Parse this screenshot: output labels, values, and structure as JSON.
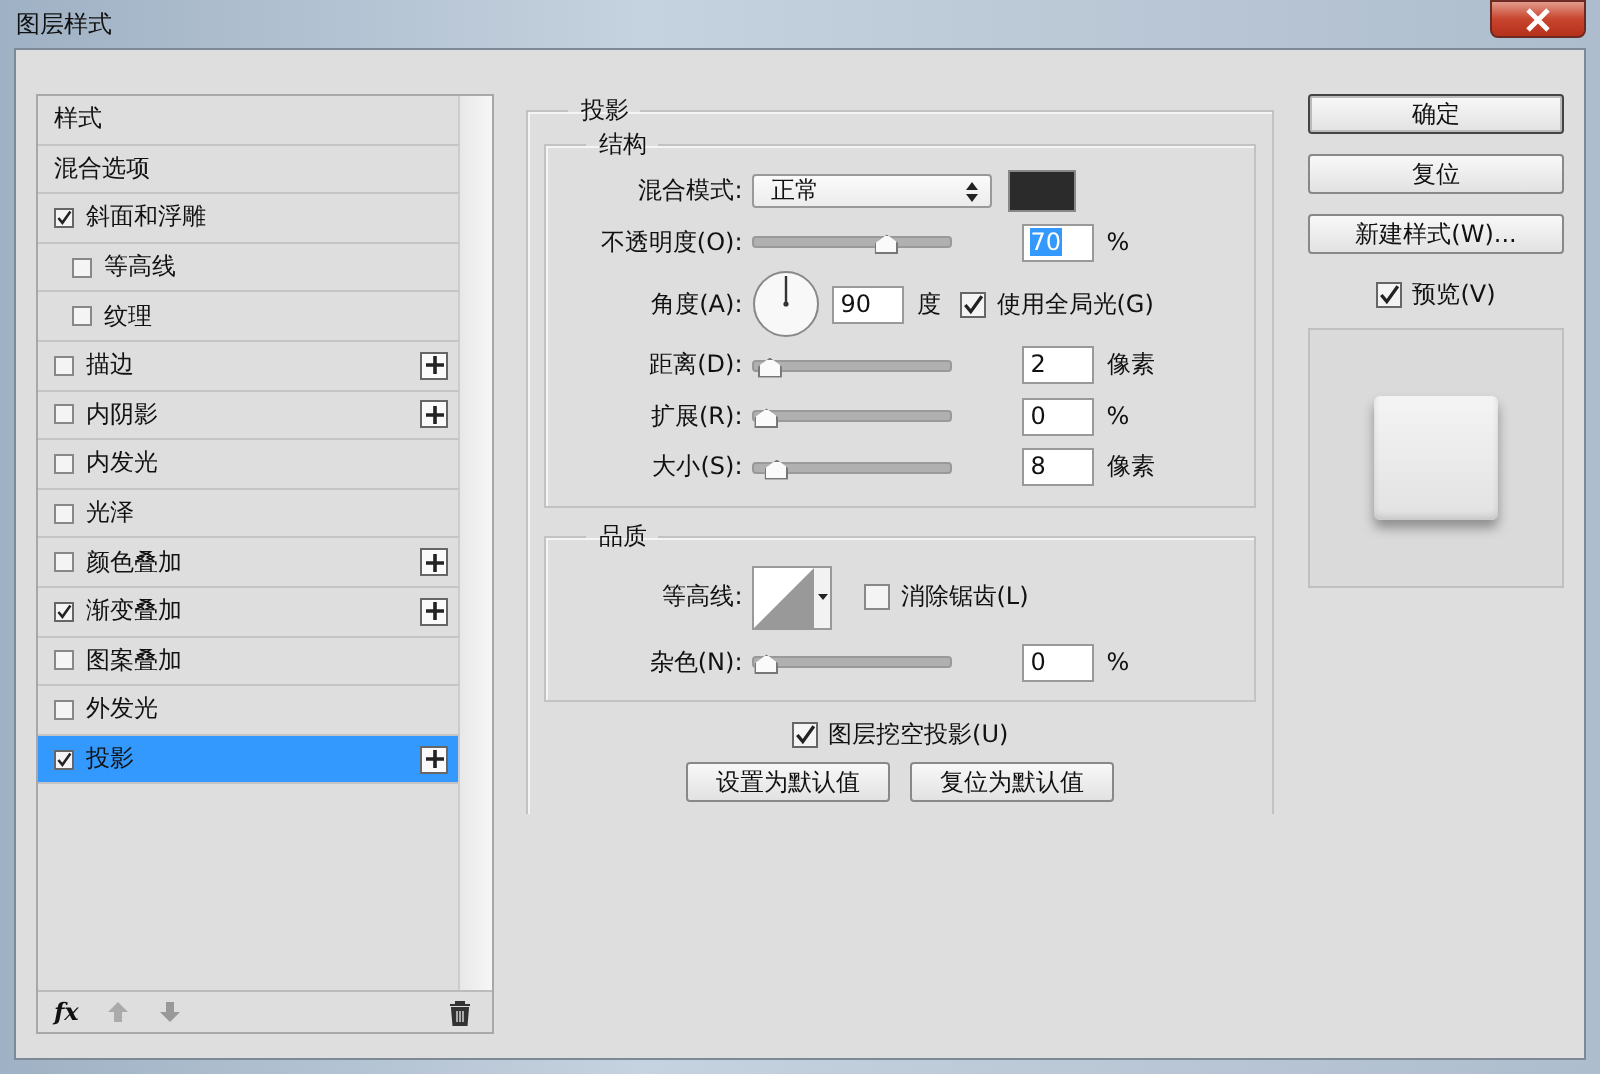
{
  "window": {
    "title": "图层样式"
  },
  "styles": {
    "items": [
      {
        "kind": "header",
        "label": "样式",
        "selected": false
      },
      {
        "kind": "plain",
        "label": "混合选项",
        "selected": false
      },
      {
        "kind": "check",
        "label": "斜面和浮雕",
        "checked": true,
        "selected": false,
        "plus": false,
        "children": [
          {
            "kind": "check",
            "label": "等高线",
            "checked": false,
            "selected": false,
            "plus": false
          },
          {
            "kind": "check",
            "label": "纹理",
            "checked": false,
            "selected": false,
            "plus": false
          }
        ]
      },
      {
        "kind": "check",
        "label": "描边",
        "checked": false,
        "selected": false,
        "plus": true
      },
      {
        "kind": "check",
        "label": "内阴影",
        "checked": false,
        "selected": false,
        "plus": true
      },
      {
        "kind": "check",
        "label": "内发光",
        "checked": false,
        "selected": false,
        "plus": false
      },
      {
        "kind": "check",
        "label": "光泽",
        "checked": false,
        "selected": false,
        "plus": false
      },
      {
        "kind": "check",
        "label": "颜色叠加",
        "checked": false,
        "selected": false,
        "plus": true
      },
      {
        "kind": "check",
        "label": "渐变叠加",
        "checked": true,
        "selected": false,
        "plus": true
      },
      {
        "kind": "check",
        "label": "图案叠加",
        "checked": false,
        "selected": false,
        "plus": false
      },
      {
        "kind": "check",
        "label": "外发光",
        "checked": false,
        "selected": false,
        "plus": false
      },
      {
        "kind": "check",
        "label": "投影",
        "checked": true,
        "selected": true,
        "plus": true
      }
    ],
    "footer": {
      "fx": "fx"
    }
  },
  "panel": {
    "title": "投影",
    "structure": {
      "title": "结构",
      "blend_mode": {
        "label": "混合模式:",
        "value": "正常"
      },
      "opacity": {
        "label": "不透明度(O):",
        "level": 0.7,
        "value": "70",
        "unit": "%",
        "selected": true
      },
      "angle": {
        "label": "角度(A):",
        "value": "90",
        "unit": "度",
        "global_light": {
          "label": "使用全局光(G)",
          "checked": true
        }
      },
      "sliders": [
        {
          "label": "距离(D):",
          "level": 0.02,
          "value": "2",
          "unit": "像素",
          "selected": false
        },
        {
          "label": "扩展(R):",
          "level": 0,
          "value": "0",
          "unit": "%",
          "selected": false
        },
        {
          "label": "大小(S):",
          "level": 0.06,
          "value": "8",
          "unit": "像素",
          "selected": false
        }
      ]
    },
    "quality": {
      "title": "品质",
      "contour": {
        "label": "等高线:",
        "antialias": {
          "label": "消除锯齿(L)",
          "checked": false
        }
      },
      "noise": {
        "label": "杂色(N):",
        "level": 0,
        "value": "0",
        "unit": "%",
        "selected": false
      }
    },
    "knockout": {
      "label": "图层挖空投影(U)",
      "checked": true
    },
    "buttons": [
      "设置为默认值",
      "复位为默认值"
    ]
  },
  "side": {
    "buttons": [
      {
        "label": "确定",
        "default": true
      },
      {
        "label": "复位",
        "default": false
      },
      {
        "label": "新建样式(W)...",
        "default": false
      }
    ],
    "preview": {
      "label": "预览(V)",
      "checked": true
    }
  }
}
